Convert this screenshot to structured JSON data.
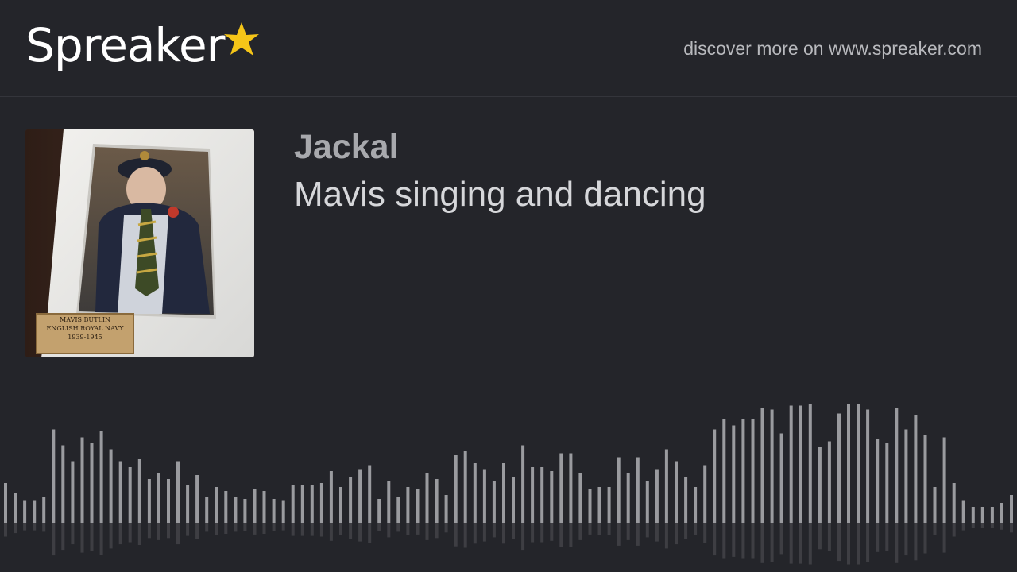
{
  "header": {
    "logo_text": "Spreaker",
    "logo_star_color": "#f5c518",
    "tagline": "discover more on www.spreaker.com"
  },
  "episode": {
    "author": "Jackal",
    "title": "Mavis singing and dancing",
    "cover_icon": "framed-portrait-photo",
    "cover_plaque_lines": [
      "MAVIS BUTLIN",
      "ENGLISH ROYAL NAVY",
      "1939-1945"
    ]
  },
  "waveform": {
    "bar_color": "#9a9b9f",
    "levels": [
      0.2,
      0.15,
      0.11,
      0.11,
      0.13,
      0.47,
      0.39,
      0.31,
      0.43,
      0.4,
      0.46,
      0.37,
      0.31,
      0.28,
      0.32,
      0.22,
      0.25,
      0.22,
      0.31,
      0.19,
      0.24,
      0.13,
      0.18,
      0.16,
      0.13,
      0.12,
      0.17,
      0.16,
      0.12,
      0.11,
      0.19,
      0.19,
      0.19,
      0.2,
      0.26,
      0.18,
      0.23,
      0.27,
      0.29,
      0.12,
      0.21,
      0.13,
      0.18,
      0.17,
      0.25,
      0.22,
      0.14,
      0.34,
      0.36,
      0.3,
      0.27,
      0.21,
      0.3,
      0.23,
      0.39,
      0.28,
      0.28,
      0.26,
      0.35,
      0.35,
      0.25,
      0.17,
      0.18,
      0.18,
      0.33,
      0.25,
      0.33,
      0.21,
      0.27,
      0.37,
      0.31,
      0.23,
      0.18,
      0.29,
      0.47,
      0.52,
      0.49,
      0.52,
      0.52,
      0.58,
      0.57,
      0.45,
      0.59,
      0.59,
      0.6,
      0.38,
      0.41,
      0.55,
      0.6,
      0.6,
      0.57,
      0.42,
      0.4,
      0.58,
      0.47,
      0.54,
      0.44,
      0.18,
      0.43,
      0.2,
      0.11,
      0.08,
      0.08,
      0.08,
      0.1,
      0.14
    ]
  }
}
